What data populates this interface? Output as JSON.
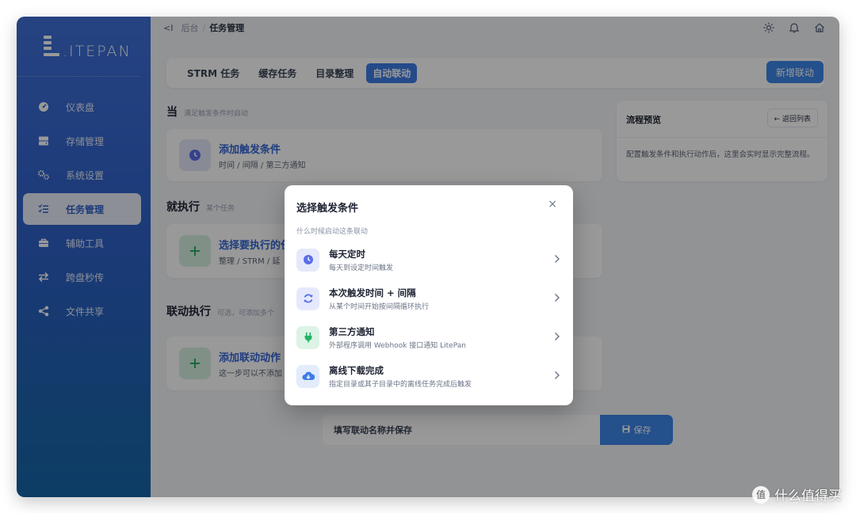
{
  "app": {
    "logo_text": ".ITEPAN"
  },
  "sidebar": {
    "items": [
      {
        "label": "仪表盘",
        "icon": "dashboard-icon"
      },
      {
        "label": "存储管理",
        "icon": "storage-icon"
      },
      {
        "label": "系统设置",
        "icon": "settings-icon"
      },
      {
        "label": "任务管理",
        "icon": "tasks-icon",
        "active": true
      },
      {
        "label": "辅助工具",
        "icon": "tools-icon"
      },
      {
        "label": "跨盘秒传",
        "icon": "transfer-icon"
      },
      {
        "label": "文件共享",
        "icon": "share-icon"
      }
    ]
  },
  "topbar": {
    "collapse": "<I",
    "breadcrumb": {
      "root": "后台",
      "sep": "/",
      "current": "任务管理"
    }
  },
  "tabs": [
    {
      "label": "STRM 任务"
    },
    {
      "label": "缓存任务"
    },
    {
      "label": "目录整理"
    },
    {
      "label": "自动联动",
      "active": true
    }
  ],
  "new_button": "新增联动",
  "when": {
    "title": "当",
    "hint": "满足触发条件时启动",
    "card_title": "添加触发条件",
    "card_sub": "时间 / 间隔 / 第三方通知"
  },
  "then": {
    "title": "就执行",
    "hint": "某个任务",
    "card_title": "选择要执行的任务",
    "card_sub": "整理 / STRM / 延"
  },
  "linked": {
    "title": "联动执行",
    "hint": "可选，可添加多个",
    "card_title": "添加联动动作",
    "card_sub": "这一步可以不添加"
  },
  "preview": {
    "title": "流程预览",
    "back": "← 返回列表",
    "desc": "配置触发条件和执行动作后，这里会实时显示完整流程。"
  },
  "save": {
    "placeholder": "填写联动名称并保存",
    "button": "保存"
  },
  "modal": {
    "title": "选择触发条件",
    "close": "×",
    "subtitle": "什么时候启动这条联动",
    "options": [
      {
        "title": "每天定时",
        "sub": "每天到设定时间触发",
        "icon": "clock-icon",
        "color": "#5b6fe8",
        "bg": "#e6e9fb"
      },
      {
        "title": "本次触发时间 + 间隔",
        "sub": "从某个时间开始按间隔循环执行",
        "icon": "refresh-icon",
        "color": "#5b6fe8",
        "bg": "#e6e9fb"
      },
      {
        "title": "第三方通知",
        "sub": "外部程序调用 Webhook 接口通知 LitePan",
        "icon": "plug-icon",
        "color": "#27b36a",
        "bg": "#dcf3e6"
      },
      {
        "title": "离线下载完成",
        "sub": "指定目录或其子目录中的离线任务完成后触发",
        "icon": "cloud-download-icon",
        "color": "#3d7ce6",
        "bg": "#e2ecfb"
      }
    ]
  },
  "watermark": {
    "symbol": "值",
    "text": "什么值得买"
  }
}
